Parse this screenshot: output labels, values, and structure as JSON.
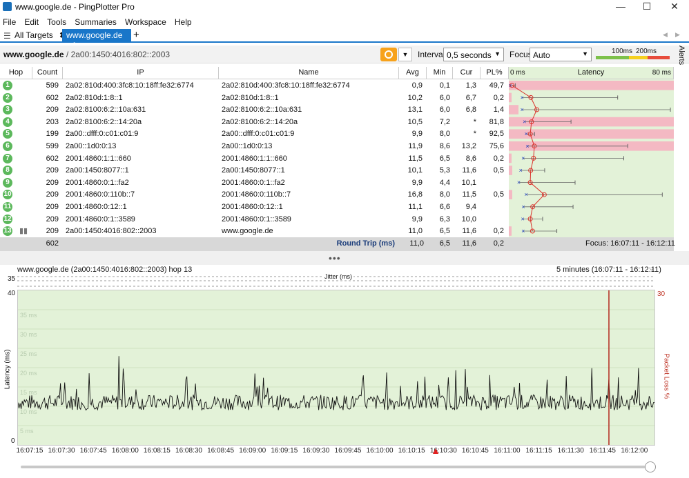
{
  "window": {
    "title": "www.google.de - PingPlotter Pro",
    "minimize": "—",
    "maximize": "☐",
    "close": "✕"
  },
  "menu": [
    "File",
    "Edit",
    "Tools",
    "Summaries",
    "Workspace",
    "Help"
  ],
  "tabs": {
    "all_targets": "All Targets",
    "active": "www.google.de",
    "add": "+"
  },
  "target": {
    "name": "www.google.de",
    "ip": " / 2a00:1450:4016:802::2003",
    "interval_label": "Interval",
    "interval_value": "0,5 seconds",
    "focus_label": "Focus",
    "focus_value": "Auto",
    "threshold_100": "100ms",
    "threshold_200": "200ms",
    "alerts": "Alerts"
  },
  "colors": {
    "accent": "#1976c9",
    "hop_green": "#5cb85c",
    "latency_bg": "#e3f2d8",
    "loss_pink": "#f4b9c3",
    "line_red": "#d9322b",
    "pause_orange": "#f7a21b"
  },
  "table": {
    "headers": {
      "hop": "Hop",
      "count": "Count",
      "ip": "IP",
      "name": "Name",
      "avg": "Avg",
      "min": "Min",
      "cur": "Cur",
      "pl": "PL%",
      "latency": "Latency",
      "lat_min": "0 ms",
      "lat_max": "80 ms"
    },
    "rows": [
      {
        "hop": "1",
        "count": "599",
        "ip": "2a02:810d:400:3fc8:10:18ff:fe32:6774",
        "name": "2a02:810d:400:3fc8:10:18ff:fe32:6774",
        "avg": "0,9",
        "min": "0,1",
        "cur": "1,3",
        "pl": "49,7",
        "avg_ms": 0.9,
        "min_ms": 0.1,
        "max_ms": 2.5,
        "pl_pct": 49.7
      },
      {
        "hop": "2",
        "count": "602",
        "ip": "2a02:810d:1:8::1",
        "name": "2a02:810d:1:8::1",
        "avg": "10,2",
        "min": "6,0",
        "cur": "6,7",
        "pl": "0,2",
        "avg_ms": 10.2,
        "min_ms": 6.0,
        "max_ms": 53,
        "pl_pct": 0.2
      },
      {
        "hop": "3",
        "count": "209",
        "ip": "2a02:8100:6:2::10a:631",
        "name": "2a02:8100:6:2::10a:631",
        "avg": "13,1",
        "min": "6,0",
        "cur": "6,8",
        "pl": "1,4",
        "avg_ms": 13.1,
        "min_ms": 6.0,
        "max_ms": 79,
        "pl_pct": 1.4
      },
      {
        "hop": "4",
        "count": "203",
        "ip": "2a02:8100:6:2::14:20a",
        "name": "2a02:8100:6:2::14:20a",
        "avg": "10,5",
        "min": "7,2",
        "cur": "*",
        "pl": "81,8",
        "avg_ms": 10.5,
        "min_ms": 7.2,
        "max_ms": 30,
        "pl_pct": 81.8
      },
      {
        "hop": "5",
        "count": "199",
        "ip": "2a00::dfff:0:c01:c01:9",
        "name": "2a00::dfff:0:c01:c01:9",
        "avg": "9,9",
        "min": "8,0",
        "cur": "*",
        "pl": "92,5",
        "avg_ms": 9.9,
        "min_ms": 8.0,
        "max_ms": 12,
        "pl_pct": 92.5
      },
      {
        "hop": "6",
        "count": "599",
        "ip": "2a00::1d0:0:13",
        "name": "2a00::1d0:0:13",
        "avg": "11,9",
        "min": "8,6",
        "cur": "13,2",
        "pl": "75,6",
        "avg_ms": 11.9,
        "min_ms": 8.6,
        "max_ms": 58,
        "pl_pct": 75.6
      },
      {
        "hop": "7",
        "count": "602",
        "ip": "2001:4860:1:1::660",
        "name": "2001:4860:1:1::660",
        "avg": "11,5",
        "min": "6,5",
        "cur": "8,6",
        "pl": "0,2",
        "avg_ms": 11.5,
        "min_ms": 6.5,
        "max_ms": 56,
        "pl_pct": 0.2
      },
      {
        "hop": "8",
        "count": "209",
        "ip": "2a00:1450:8077::1",
        "name": "2a00:1450:8077::1",
        "avg": "10,1",
        "min": "5,3",
        "cur": "11,6",
        "pl": "0,5",
        "avg_ms": 10.1,
        "min_ms": 5.3,
        "max_ms": 17,
        "pl_pct": 0.5
      },
      {
        "hop": "9",
        "count": "209",
        "ip": "2001:4860:0:1::fa2",
        "name": "2001:4860:0:1::fa2",
        "avg": "9,9",
        "min": "4,4",
        "cur": "10,1",
        "pl": "",
        "avg_ms": 9.9,
        "min_ms": 4.4,
        "max_ms": 32,
        "pl_pct": 0
      },
      {
        "hop": "10",
        "count": "209",
        "ip": "2001:4860:0:110b::7",
        "name": "2001:4860:0:110b::7",
        "avg": "16,8",
        "min": "8,0",
        "cur": "11,5",
        "pl": "0,5",
        "avg_ms": 16.8,
        "min_ms": 8.0,
        "max_ms": 75,
        "pl_pct": 0.5
      },
      {
        "hop": "11",
        "count": "209",
        "ip": "2001:4860:0:12::1",
        "name": "2001:4860:0:12::1",
        "avg": "11,1",
        "min": "6,6",
        "cur": "9,4",
        "pl": "",
        "avg_ms": 11.1,
        "min_ms": 6.6,
        "max_ms": 31,
        "pl_pct": 0
      },
      {
        "hop": "12",
        "count": "209",
        "ip": "2001:4860:0:1::3589",
        "name": "2001:4860:0:1::3589",
        "avg": "9,9",
        "min": "6,3",
        "cur": "10,0",
        "pl": "",
        "avg_ms": 9.9,
        "min_ms": 6.3,
        "max_ms": 16,
        "pl_pct": 0
      },
      {
        "hop": "13",
        "count": "209",
        "ip": "2a00:1450:4016:802::2003",
        "name": "www.google.de",
        "avg": "11,0",
        "min": "6,5",
        "cur": "11,6",
        "pl": "0,2",
        "avg_ms": 11.0,
        "min_ms": 6.5,
        "max_ms": 23,
        "pl_pct": 0.2
      }
    ],
    "totals": {
      "count": "602",
      "label": "Round Trip (ms)",
      "avg": "11,0",
      "min": "6,5",
      "cur": "11,6",
      "pl": "0,2",
      "focus": "Focus: 16:07:11 - 16:12:11"
    }
  },
  "graph": {
    "title": "www.google.de (2a00:1450:4016:802::2003) hop 13",
    "range": "5 minutes (16:07:11 - 16:12:11)",
    "jitter_label": "Jitter (ms)",
    "jitter_top": "35",
    "y_top": "40",
    "y_bottom": "0",
    "right_top": "30",
    "y_label": "Latency (ms)",
    "right_label": "Packet Loss %",
    "gridlines": [
      "35 ms",
      "30 ms",
      "25 ms",
      "20 ms",
      "15 ms",
      "10 ms",
      "5 ms"
    ],
    "x_ticks": [
      "16:07:15",
      "16:07:30",
      "16:07:45",
      "16:08:00",
      "16:08:15",
      "16:08:30",
      "16:08:45",
      "16:09:00",
      "16:09:15",
      "16:09:30",
      "16:09:45",
      "16:10:00",
      "16:10:15",
      "16:10:30",
      "16:10:45",
      "16:11:00",
      "16:11:15",
      "16:11:30",
      "16:11:45",
      "16:12:00"
    ]
  }
}
